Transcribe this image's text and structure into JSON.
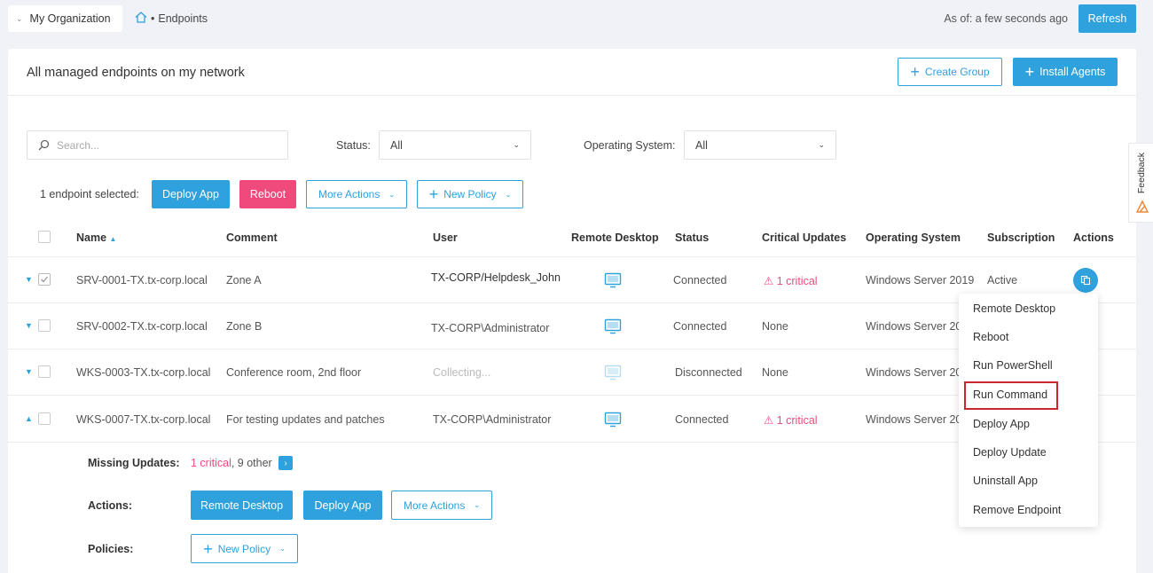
{
  "topbar": {
    "org": "My Organization",
    "breadcrumb_sep": "•",
    "breadcrumb": "Endpoints",
    "as_of": "As of: a few seconds ago",
    "refresh": "Refresh"
  },
  "panel": {
    "title": "All managed endpoints on my network",
    "create_group": "Create Group",
    "install_agents": "Install Agents"
  },
  "filters": {
    "search_placeholder": "Search...",
    "status_label": "Status:",
    "status_value": "All",
    "os_label": "Operating System:",
    "os_value": "All"
  },
  "bulk": {
    "selected": "1 endpoint selected:",
    "deploy_app": "Deploy App",
    "reboot": "Reboot",
    "more_actions": "More Actions",
    "new_policy": "New Policy"
  },
  "columns": [
    "Name",
    "Comment",
    "User",
    "Remote Desktop",
    "Status",
    "Critical Updates",
    "Operating System",
    "Subscription",
    "Actions"
  ],
  "rows": [
    {
      "name": "SRV-0001-TX.tx-corp.local",
      "comment": "Zone A",
      "user": "TX-CORP/Helpdesk_John",
      "status": "Connected",
      "critical": "1 critical",
      "os": "Windows Server 2019",
      "subscription": "Active"
    },
    {
      "name": "SRV-0002-TX.tx-corp.local",
      "comment": "Zone B",
      "user": "TX-CORP\\Administrator",
      "status": "Connected",
      "critical": "None",
      "os": "Windows Server 20",
      "subscription": ""
    },
    {
      "name": "WKS-0003-TX.tx-corp.local",
      "comment": "Conference room, 2nd floor",
      "user": "Collecting...",
      "status": "Disconnected",
      "critical": "None",
      "os": "Windows Server 20",
      "subscription": ""
    },
    {
      "name": "WKS-0007-TX.tx-corp.local",
      "comment": "For testing updates and patches",
      "user": "TX-CORP\\Administrator",
      "status": "Connected",
      "critical": "1 critical",
      "os": "Windows Server 20",
      "subscription": ""
    }
  ],
  "detail": {
    "missing_label": "Missing Updates:",
    "missing_critical": "1 critical",
    "missing_other": ", 9 other",
    "actions_label": "Actions:",
    "remote_desktop": "Remote Desktop",
    "deploy_app": "Deploy App",
    "more_actions": "More Actions",
    "policies_label": "Policies:",
    "new_policy": "New Policy"
  },
  "menu": [
    "Remote Desktop",
    "Reboot",
    "Run PowerShell",
    "Run Command",
    "Deploy App",
    "Deploy Update",
    "Uninstall App",
    "Remove Endpoint"
  ],
  "feedback": "Feedback",
  "colors": {
    "accent": "#2fa1dc",
    "danger": "#f04a7d",
    "highlight": "#c8272d"
  }
}
